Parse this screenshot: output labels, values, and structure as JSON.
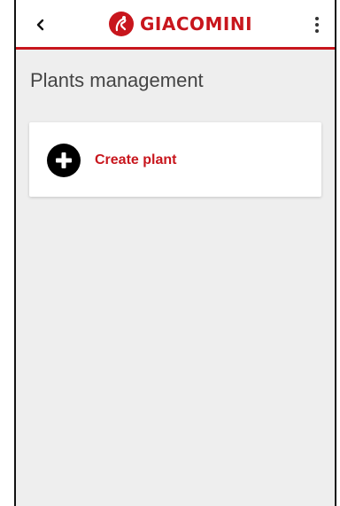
{
  "header": {
    "brand": "GIACOMINI",
    "back_icon": "chevron-left-icon",
    "menu_icon": "more-vertical-icon",
    "accent_color": "#c8161d"
  },
  "page": {
    "title": "Plants management"
  },
  "actions": {
    "create_label": "Create plant",
    "create_icon": "add-circle-icon"
  }
}
